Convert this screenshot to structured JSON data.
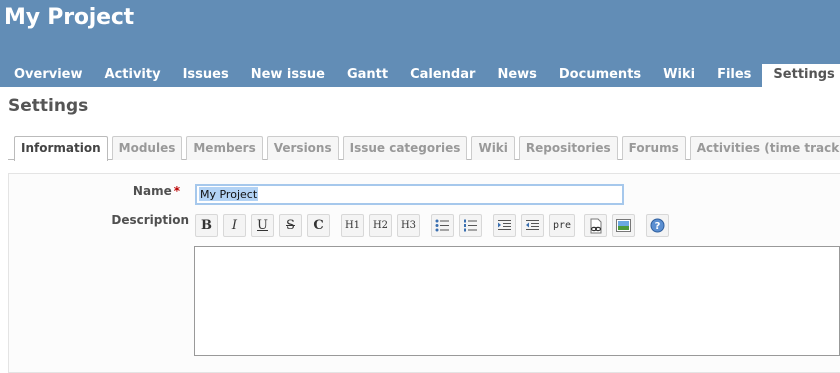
{
  "header": {
    "project_title": "My Project",
    "menu": [
      {
        "label": "Overview"
      },
      {
        "label": "Activity"
      },
      {
        "label": "Issues"
      },
      {
        "label": "New issue"
      },
      {
        "label": "Gantt"
      },
      {
        "label": "Calendar"
      },
      {
        "label": "News"
      },
      {
        "label": "Documents"
      },
      {
        "label": "Wiki"
      },
      {
        "label": "Files"
      },
      {
        "label": "Settings",
        "selected": true
      }
    ]
  },
  "page": {
    "heading": "Settings",
    "tabs": [
      {
        "label": "Information",
        "selected": true
      },
      {
        "label": "Modules"
      },
      {
        "label": "Members"
      },
      {
        "label": "Versions"
      },
      {
        "label": "Issue categories"
      },
      {
        "label": "Wiki"
      },
      {
        "label": "Repositories"
      },
      {
        "label": "Forums"
      },
      {
        "label": "Activities (time tracking)"
      }
    ]
  },
  "form": {
    "name_label": "Name",
    "required_marker": "*",
    "name_value": "My Project",
    "description_label": "Description",
    "description_value": ""
  },
  "toolbar": {
    "buttons": [
      {
        "name": "bold",
        "text": "B"
      },
      {
        "name": "italic",
        "text": "I"
      },
      {
        "name": "underline",
        "text": "U"
      },
      {
        "name": "strikethrough",
        "text": "S"
      },
      {
        "name": "code",
        "text": "C"
      },
      {
        "name": "heading-1",
        "text": "H1"
      },
      {
        "name": "heading-2",
        "text": "H2"
      },
      {
        "name": "heading-3",
        "text": "H3"
      },
      {
        "name": "unordered-list",
        "icon": "bulleted-list-icon"
      },
      {
        "name": "ordered-list",
        "icon": "numbered-list-icon"
      },
      {
        "name": "quote",
        "icon": "indent-right-icon"
      },
      {
        "name": "unquote",
        "icon": "indent-left-icon"
      },
      {
        "name": "preformatted",
        "text": "pre"
      },
      {
        "name": "wiki-link",
        "icon": "link-page-icon"
      },
      {
        "name": "image",
        "icon": "image-icon"
      },
      {
        "name": "help",
        "icon": "help-icon"
      }
    ]
  },
  "colors": {
    "header_bg": "#628db6",
    "required": "#bb0000",
    "input_focus_border": "#a6c8ec"
  }
}
